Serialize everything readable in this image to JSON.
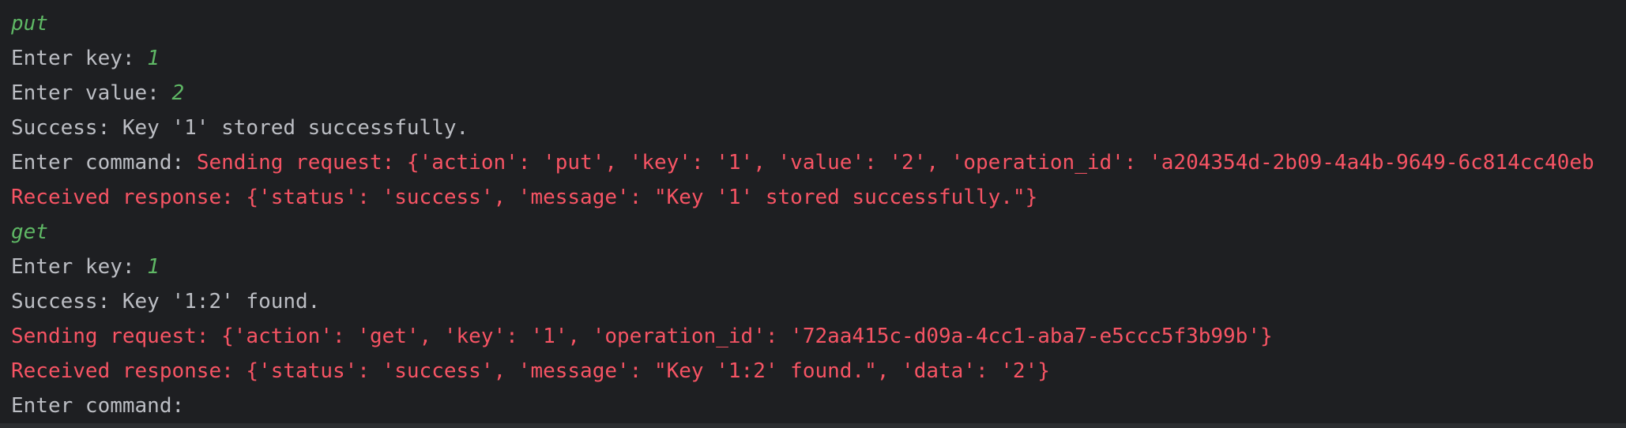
{
  "console": {
    "lines": [
      {
        "type": "input",
        "text": "put"
      },
      {
        "type": "prompt",
        "prompt": "Enter key: ",
        "value": "1"
      },
      {
        "type": "prompt",
        "prompt": "Enter value: ",
        "value": "2"
      },
      {
        "type": "stdout",
        "text": "Success: Key '1' stored successfully."
      },
      {
        "type": "mixed",
        "prompt": "Enter command: ",
        "text": "Sending request: {'action': 'put', 'key': '1', 'value': '2', 'operation_id': 'a204354d-2b09-4a4b-9649-6c814cc40eb"
      },
      {
        "type": "stderr",
        "text": "Received response: {'status': 'success', 'message': \"Key '1' stored successfully.\"}"
      },
      {
        "type": "input",
        "text": "get"
      },
      {
        "type": "prompt",
        "prompt": "Enter key: ",
        "value": "1"
      },
      {
        "type": "stdout",
        "text": "Success: Key '1:2' found."
      },
      {
        "type": "stderr",
        "text": "Sending request: {'action': 'get', 'key': '1', 'operation_id': '72aa415c-d09a-4cc1-aba7-e5ccc5f3b99b'}"
      },
      {
        "type": "stderr",
        "text": "Received response: {'status': 'success', 'message': \"Key '1:2' found.\", 'data': '2'}"
      },
      {
        "type": "stdout",
        "text": "Enter command: "
      }
    ]
  },
  "colors": {
    "background": "#1e1f22",
    "stdout": "#bcbec4",
    "stderr": "#f75464",
    "user_input": "#5fb865"
  }
}
